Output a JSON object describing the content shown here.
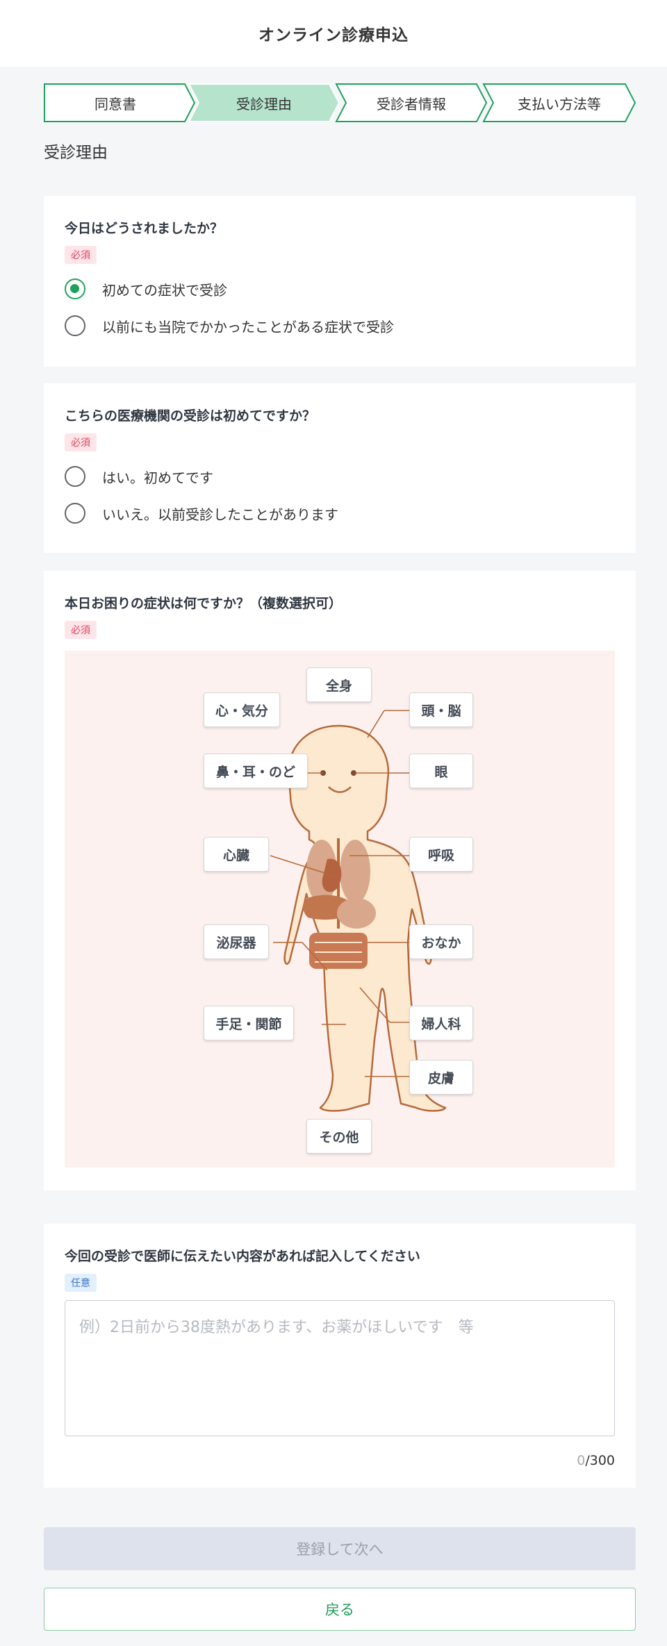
{
  "header": {
    "title": "オンライン診療申込"
  },
  "steps": [
    {
      "label": "同意書",
      "active": false
    },
    {
      "label": "受診理由",
      "active": true
    },
    {
      "label": "受診者情報",
      "active": false
    },
    {
      "label": "支払い方法等",
      "active": false
    }
  ],
  "colors": {
    "accent": "#1fa25e",
    "step_active": "#b5e3cc",
    "required": "#e0435c",
    "optional": "#3573c9"
  },
  "section_title": "受診理由",
  "q1": {
    "question": "今日はどうされましたか？",
    "badge": "必須",
    "options": [
      "初めての症状で受診",
      "以前にも当院でかかったことがある症状で受診"
    ],
    "selected": 0
  },
  "q2": {
    "question": "こちらの医療機関の受診は初めてですか？",
    "badge": "必須",
    "options": [
      "はい。初めてです",
      "いいえ。以前受診したことがあります"
    ]
  },
  "q3": {
    "question": "本日お困りの症状は何ですか？（複数選択可）",
    "badge": "必須",
    "symptoms": {
      "whole_body": "全身",
      "mind": "心・気分",
      "head": "頭・脳",
      "ent": "鼻・耳・のど",
      "eye": "眼",
      "heart": "心臓",
      "breath": "呼吸",
      "urinary": "泌尿器",
      "stomach": "おなか",
      "limbs": "手足・関節",
      "gyn": "婦人科",
      "skin": "皮膚",
      "other": "その他"
    }
  },
  "q4": {
    "question": "今回の受診で医師に伝えたい内容があれば記入してください",
    "badge": "任意",
    "placeholder": "例）2日前から38度熱があります、お薬がほしいです　等",
    "count": "0",
    "max": "/300"
  },
  "buttons": {
    "next": "登録して次へ",
    "back": "戻る"
  }
}
